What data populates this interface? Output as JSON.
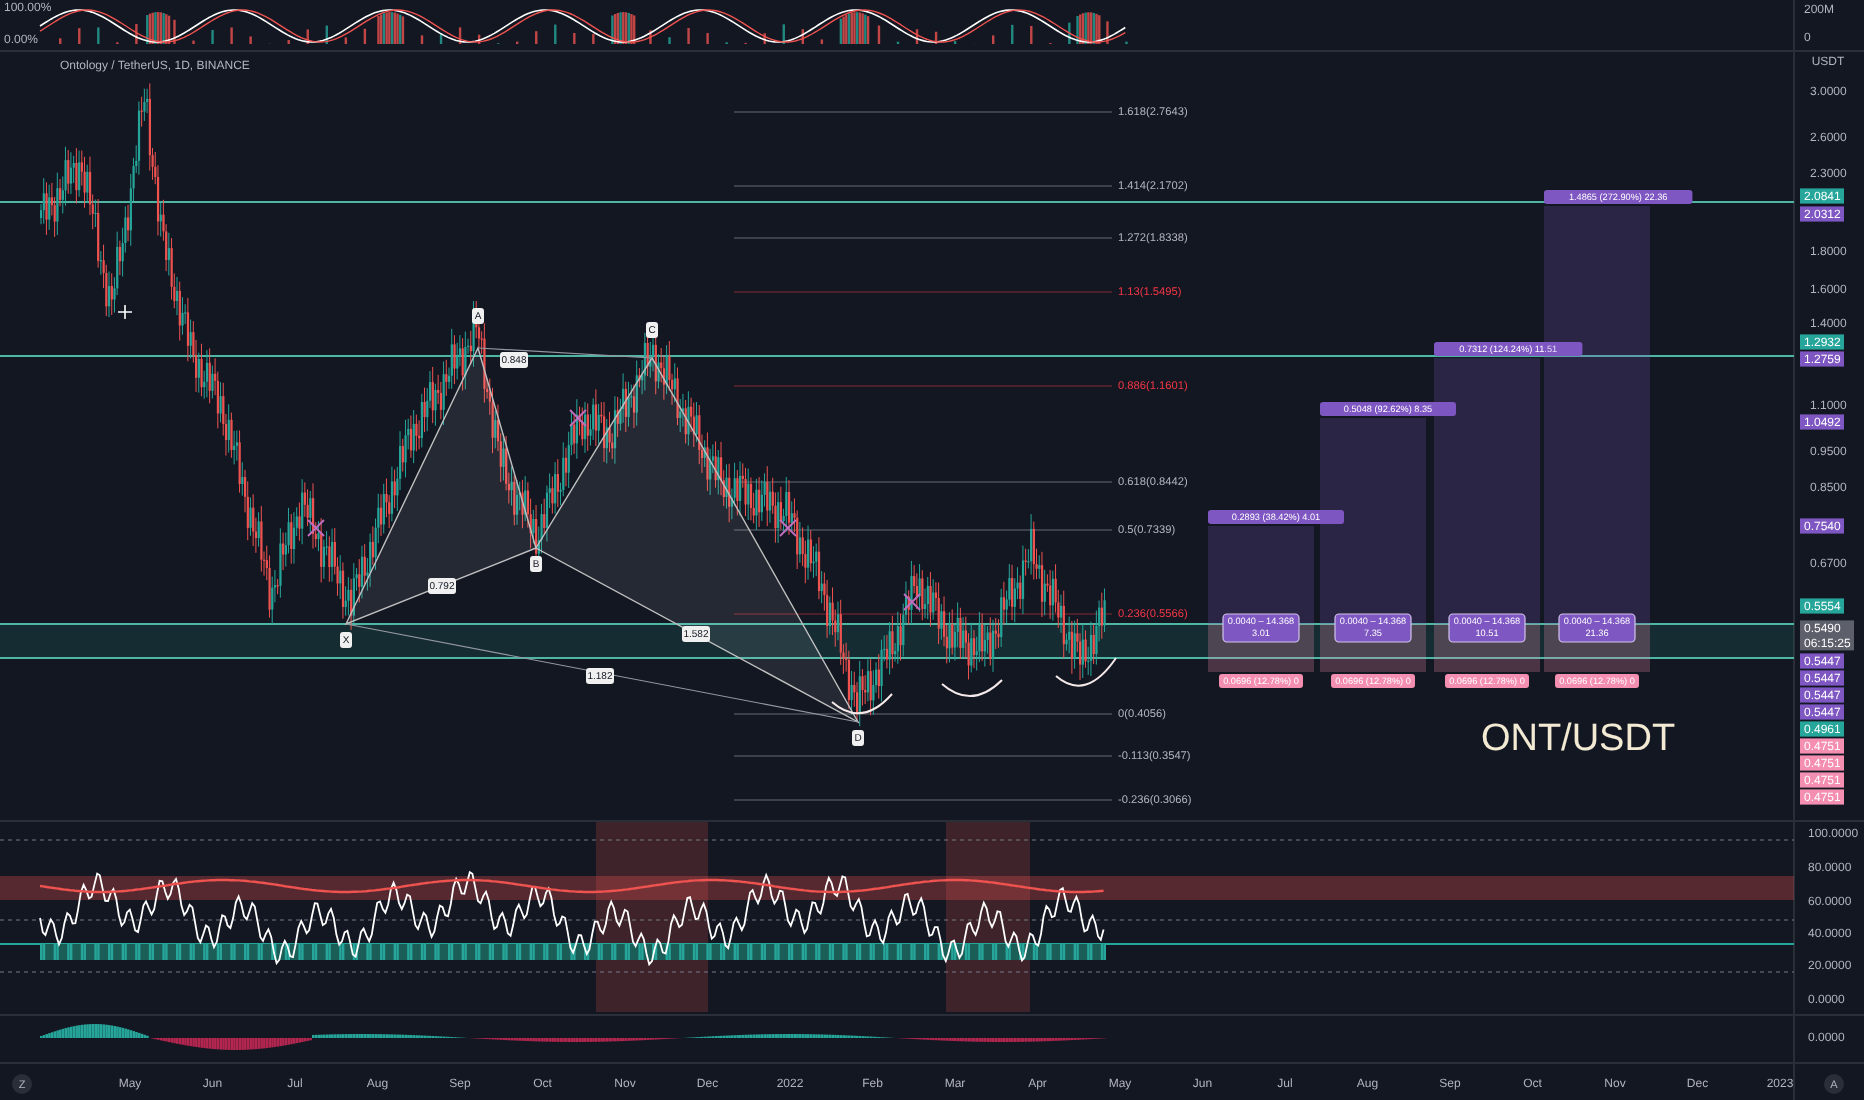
{
  "top_pane": {
    "left_axis": [
      "100.00%",
      "0.00%"
    ],
    "right_axis": [
      "200M",
      "0"
    ]
  },
  "symbol_title": "Ontology / TetherUS, 1D, BINANCE",
  "price_axis": {
    "currency": "USDT",
    "ticks": [
      "3.0000",
      "2.6000",
      "2.3000",
      "1.8000",
      "1.6000",
      "1.4000",
      "1.1000",
      "0.9500",
      "0.8500",
      "0.6700"
    ]
  },
  "price_badges": [
    {
      "text": "2.0841",
      "color": "#26a69a"
    },
    {
      "text": "2.0312",
      "color": "#7e57c2"
    },
    {
      "text": "1.2932",
      "color": "#26a69a"
    },
    {
      "text": "1.2759",
      "color": "#7e57c2"
    },
    {
      "text": "1.0492",
      "color": "#7e57c2"
    },
    {
      "text": "0.7540",
      "color": "#7e57c2"
    },
    {
      "text": "0.5554",
      "color": "#26a69a"
    },
    {
      "text": "0.5490",
      "countdown": "06:15:25",
      "color": "#5d606b"
    },
    {
      "text": "0.5447",
      "color": "#7e57c2"
    },
    {
      "text": "0.5447",
      "color": "#7e57c2"
    },
    {
      "text": "0.5447",
      "color": "#7e57c2"
    },
    {
      "text": "0.5447",
      "color": "#7e57c2"
    },
    {
      "text": "0.4961",
      "color": "#26a69a"
    },
    {
      "text": "0.4751",
      "color": "#f48fb1"
    },
    {
      "text": "0.4751",
      "color": "#f48fb1"
    },
    {
      "text": "0.4751",
      "color": "#f48fb1"
    },
    {
      "text": "0.4751",
      "color": "#f48fb1"
    }
  ],
  "fib_levels": [
    {
      "label": "1.618(2.7643)",
      "color": "#b2b5be"
    },
    {
      "label": "1.414(2.1702)",
      "color": "#b2b5be"
    },
    {
      "label": "1.272(1.8338)",
      "color": "#b2b5be"
    },
    {
      "label": "1.13(1.5495)",
      "color": "#f23645"
    },
    {
      "label": "0.886(1.1601)",
      "color": "#f23645"
    },
    {
      "label": "0.618(0.8442)",
      "color": "#b2b5be"
    },
    {
      "label": "0.5(0.7339)",
      "color": "#b2b5be"
    },
    {
      "label": "0.236(0.5566)",
      "color": "#f23645"
    },
    {
      "label": "0(0.4056)",
      "color": "#b2b5be"
    },
    {
      "label": "-0.113(0.3547)",
      "color": "#b2b5be"
    },
    {
      "label": "-0.236(0.3066)",
      "color": "#b2b5be"
    }
  ],
  "pattern": {
    "points": [
      "X",
      "A",
      "B",
      "C",
      "D"
    ],
    "ratios": [
      "0.848",
      "0.792",
      "1.582",
      "1.182"
    ]
  },
  "positions": [
    {
      "target": "0.2893 (38.42%) 4.01",
      "entry": "0.0040 – 14.368",
      "entry_ratio": "3.01",
      "stop": "0.0696 (12.78%) 0"
    },
    {
      "target": "0.5048 (92.62%) 8.35",
      "entry": "0.0040 – 14.368",
      "entry_ratio": "7.35",
      "stop": "0.0696 (12.78%) 0"
    },
    {
      "target": "0.7312 (124.24%) 11.51",
      "entry": "0.0040 – 14.368",
      "entry_ratio": "10.51",
      "stop": "0.0696 (12.78%) 0"
    },
    {
      "target": "1.4865 (272.90%) 22.36",
      "entry": "0.0040 – 14.368",
      "entry_ratio": "21.36",
      "stop": "0.0696 (12.78%) 0"
    }
  ],
  "chart_text": "ONT/USDT",
  "rsi_axis": [
    "100.0000",
    "80.0000",
    "60.0000",
    "40.0000",
    "20.0000",
    "0.0000"
  ],
  "macd_axis": [
    "0.0000"
  ],
  "time_axis": {
    "left_button": "Z",
    "labels": [
      "May",
      "Jun",
      "Jul",
      "Aug",
      "Sep",
      "Oct",
      "Nov",
      "Dec",
      "2022",
      "Feb",
      "Mar",
      "Apr",
      "May",
      "Jun",
      "Jul",
      "Aug",
      "Sep",
      "Oct",
      "Nov",
      "Dec",
      "2023"
    ],
    "right_button": "A"
  }
}
